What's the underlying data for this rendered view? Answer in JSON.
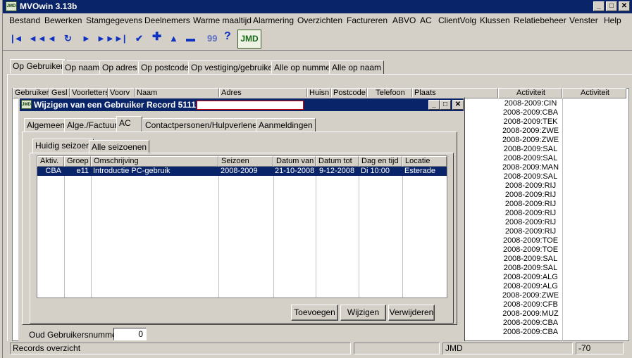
{
  "app": {
    "title": "MVOwin 3.13b",
    "logo": "JMD"
  },
  "menu": [
    "Bestand",
    "Bewerken",
    "Stamgegevens",
    "Deelnemers",
    "Warme maaltijd",
    "Alarmering",
    "Overzichten",
    "Factureren",
    "ABVO",
    "AC",
    "ClientVolg",
    "Klussen",
    "Relatiebeheer",
    "Venster",
    "Help"
  ],
  "toolbar": {
    "help_label": "?",
    "logo_label": "JMD"
  },
  "main_tabs": [
    "Op Gebruiker",
    "Op naam",
    "Op  adres",
    "Op postcode",
    "Op vestiging/gebruiker",
    "Alle op nummer",
    "Alle op naam"
  ],
  "list_headers": [
    "Gebruiker",
    "Gesl",
    "Voorletters",
    "Voorv",
    "Naam",
    "Adres",
    "Huisn",
    "Postcode",
    "Telefoon",
    "Plaats",
    "Activiteit",
    "Activiteit"
  ],
  "activities": [
    "2008-2009:CIN",
    "2008-2009:CBA",
    "2008-2009:TEK",
    "2008-2009:ZWE",
    "2008-2009:ZWE",
    "2008-2009:SAL",
    "2008-2009:SAL",
    "2008-2009:MAN",
    "2008-2009:SAL",
    "2008-2009:RIJ",
    "2008-2009:RIJ",
    "2008-2009:RIJ",
    "2008-2009:RIJ",
    "2008-2009:RIJ",
    "2008-2009:RIJ",
    "2008-2009:TOE",
    "2008-2009:TOE",
    "2008-2009:SAL",
    "2008-2009:SAL",
    "2008-2009:ALG",
    "2008-2009:ALG",
    "2008-2009:ZWE",
    "2008-2009:CFB",
    "2008-2009:MUZ",
    "2008-2009:CBA",
    "2008-2009:CBA"
  ],
  "dialog": {
    "title": "Wijzigen van een Gebruiker Record 5111",
    "tabs": [
      "Algemeen",
      "Alge./Factuur",
      "AC",
      "Contactpersonen/Hulpverleners",
      "Aanmeldingen"
    ],
    "subtabs": [
      "Huidig seizoen",
      "Alle seizoenen"
    ],
    "columns": [
      "Aktiv.",
      "Groep",
      "Omschrijving",
      "Seizoen",
      "Datum van",
      "Datum tot",
      "Dag en tijd",
      "Locatie"
    ],
    "rows": [
      {
        "aktiv": "CBA",
        "groep": "e11",
        "omschrijving": "Introductie PC-gebruik",
        "seizoen": "2008-2009",
        "datum_van": "21-10-2008",
        "datum_tot": "9-12-2008",
        "dag_tijd": "Di 10:00",
        "locatie": "Esterade"
      }
    ],
    "buttons": {
      "add": "Toevoegen",
      "edit": "Wijzigen",
      "delete": "Verwijderen"
    },
    "old_number_label": "Oud Gebruikersnummer:",
    "old_number_value": "0"
  },
  "statusbar": {
    "left": "Records overzicht",
    "user": "JMD",
    "value": "-70"
  }
}
